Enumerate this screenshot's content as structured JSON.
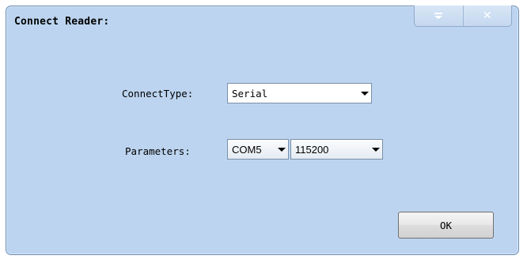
{
  "window": {
    "title": "Connect Reader:",
    "caption_buttons": [
      {
        "name": "menu",
        "icon": "menu-dropdown-icon"
      },
      {
        "name": "close",
        "icon": "close-icon",
        "glyph": "✕"
      }
    ]
  },
  "form": {
    "connect_type_label": "ConnectType:",
    "connect_type_value": "Serial",
    "parameters_label": "Parameters:",
    "port_value": "COM5",
    "baud_value": "115200"
  },
  "actions": {
    "ok_label": "OK"
  },
  "colors": {
    "window_background": "#bcd4ef",
    "border": "#6f8fb3"
  }
}
